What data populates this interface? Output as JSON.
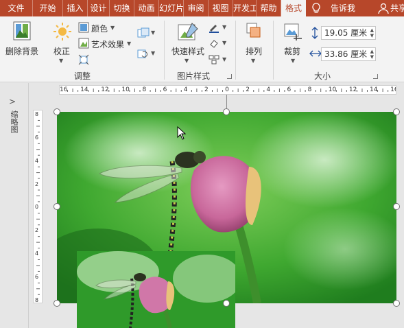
{
  "tabs": [
    "文件",
    "开始",
    "插入",
    "设计",
    "切换",
    "动画",
    "幻灯片放映",
    "审阅",
    "视图",
    "开发工具",
    "帮助",
    "格式"
  ],
  "active_tab": "格式",
  "tell_me": "告诉我",
  "share": "共享",
  "ribbon": {
    "remove_bg": "删除背景",
    "corrections": "校正",
    "color": "颜色",
    "artistic": "艺术效果",
    "group_adjust": "调整",
    "quick_styles": "快速样式",
    "group_styles": "图片样式",
    "arrange": "排列",
    "crop": "裁剪",
    "height_value": "19.05 厘米",
    "width_value": "33.86 厘米",
    "group_size": "大小"
  },
  "left_pane_label": "缩略图",
  "ruler": {
    "h_labels": [
      "16",
      "14",
      "12",
      "10",
      "8",
      "6",
      "4",
      "2",
      "0",
      "2",
      "4",
      "6",
      "8",
      "10",
      "12",
      "14",
      "16"
    ],
    "v_labels": [
      "8",
      "6",
      "4",
      "2",
      "0",
      "2",
      "4",
      "6",
      "8"
    ]
  },
  "colors": {
    "accent": "#b7472a",
    "ribbon_bg": "#f3f3f3"
  }
}
